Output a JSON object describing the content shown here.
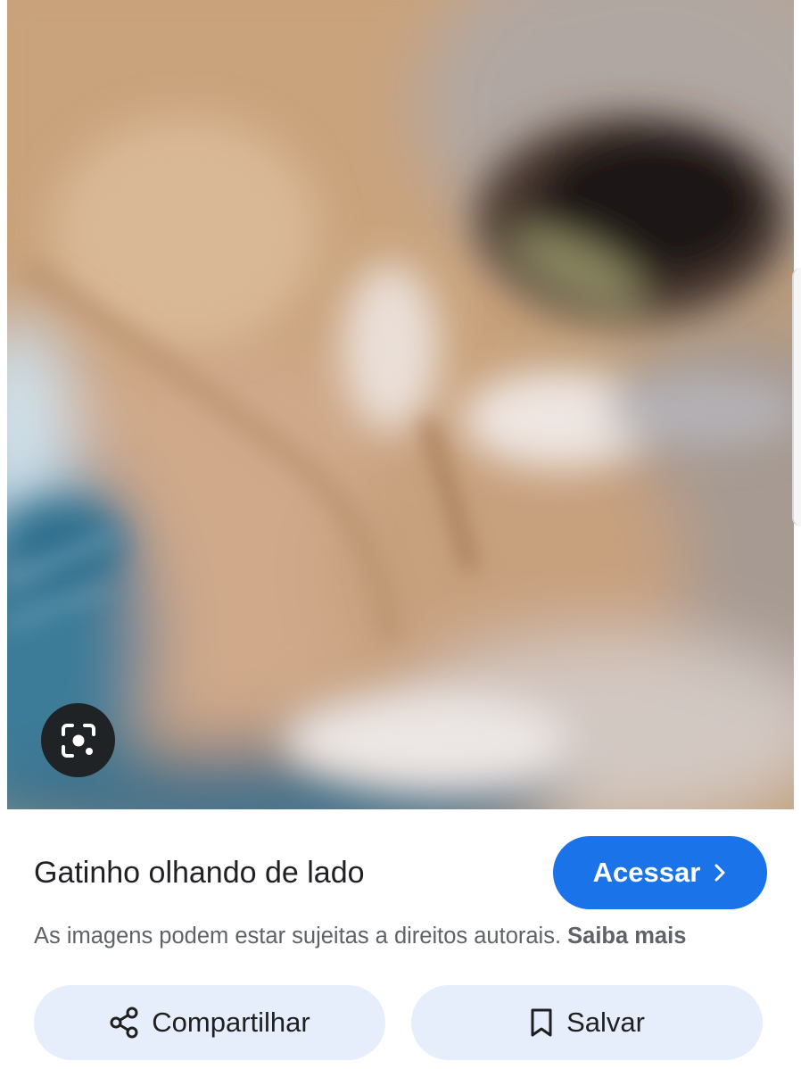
{
  "image": {
    "lens_icon": "google-lens-icon"
  },
  "result": {
    "title": "Gatinho olhando de lado",
    "visit_label": "Acessar",
    "visit_icon": "chevron-right-icon",
    "disclaimer_text": "As imagens podem estar sujeitas a direitos autorais.",
    "learn_more_label": "Saiba mais"
  },
  "actions": {
    "share_label": "Compartilhar",
    "share_icon": "share-icon",
    "save_label": "Salvar",
    "save_icon": "bookmark-icon"
  },
  "colors": {
    "accent": "#1a73e8",
    "action_bg": "#e6eefc",
    "lens_bg": "#1f2326"
  }
}
